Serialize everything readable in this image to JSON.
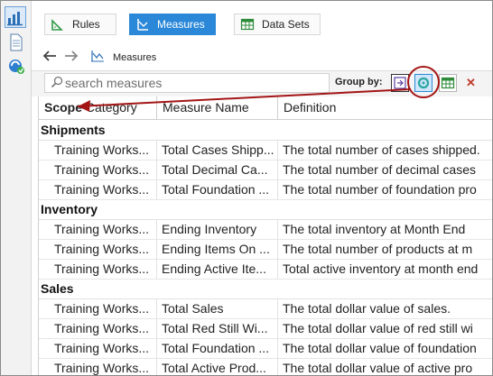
{
  "ribbon": {
    "tabs": [
      {
        "label": "Rules",
        "icon": "rules-icon"
      },
      {
        "label": "Measures",
        "icon": "measures-icon"
      },
      {
        "label": "Data Sets",
        "icon": "datasets-icon"
      }
    ]
  },
  "nav": {
    "breadcrumb": "Measures"
  },
  "toolbar": {
    "search_placeholder": "search measures",
    "group_by_label": "Group by:"
  },
  "grid": {
    "columns": [
      "Scope",
      "Category",
      "Measure Name",
      "Definition"
    ],
    "groups": [
      {
        "name": "Shipments",
        "rows": [
          {
            "category": "Training Works...",
            "measure": "Total Cases Shipp...",
            "definition": "The total number of cases shipped."
          },
          {
            "category": "Training Works...",
            "measure": "Total Decimal Ca...",
            "definition": "The total number of decimal cases"
          },
          {
            "category": "Training Works...",
            "measure": "Total Foundation ...",
            "definition": "The total number of foundation pro"
          }
        ]
      },
      {
        "name": "Inventory",
        "rows": [
          {
            "category": "Training Works...",
            "measure": "Ending Inventory",
            "definition": "The total inventory at Month End"
          },
          {
            "category": "Training Works...",
            "measure": "Ending Items On ...",
            "definition": "The total number of products at m"
          },
          {
            "category": "Training Works...",
            "measure": "Ending Active Ite...",
            "definition": "Total active inventory at month end"
          }
        ]
      },
      {
        "name": "Sales",
        "rows": [
          {
            "category": "Training Works...",
            "measure": "Total Sales",
            "definition": "The total dollar value of sales."
          },
          {
            "category": "Training Works...",
            "measure": "Total Red Still Wi...",
            "definition": "The total dollar value of red still wi"
          },
          {
            "category": "Training Works...",
            "measure": "Total Foundation ...",
            "definition": "The total dollar value of foundation"
          },
          {
            "category": "Training Works...",
            "measure": "Total Active Prod...",
            "definition": "The total dollar value of active pro"
          }
        ]
      }
    ]
  },
  "colors": {
    "accent": "#2b88d8",
    "annotation": "#a31515"
  }
}
